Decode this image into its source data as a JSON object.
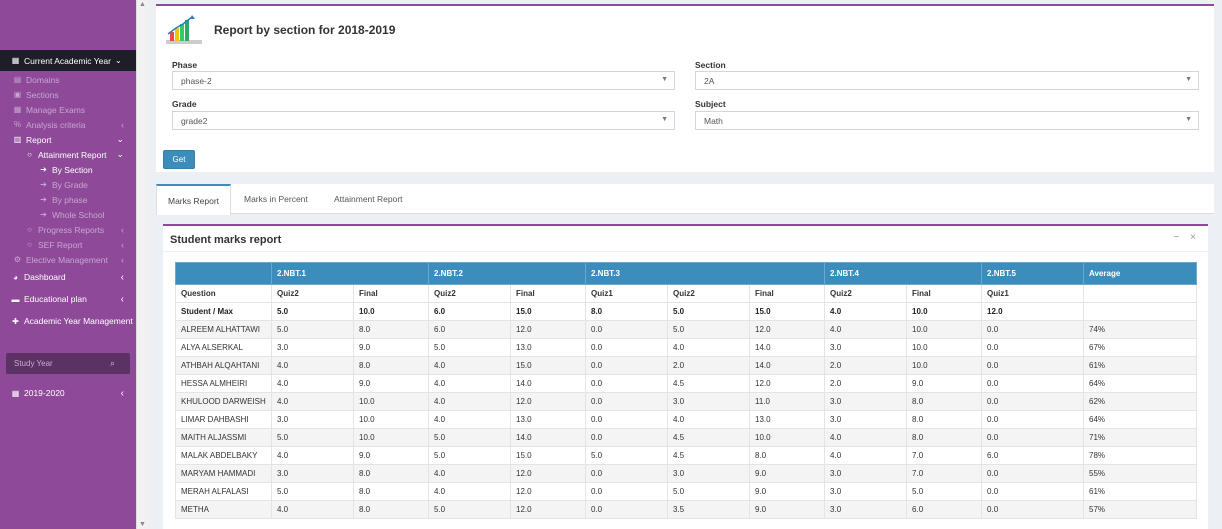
{
  "sidebar": {
    "current_label": "Current Academic Year",
    "items": [
      {
        "label": "Domains",
        "icon": "tags-icon",
        "level": 1,
        "white": false,
        "chev": ""
      },
      {
        "label": "Sections",
        "icon": "users-icon",
        "level": 1,
        "white": false,
        "chev": ""
      },
      {
        "label": "Manage Exams",
        "icon": "table-icon",
        "level": 1,
        "white": false,
        "chev": ""
      },
      {
        "label": "Analysis criteria",
        "icon": "percent-icon",
        "level": 1,
        "white": false,
        "chev": "‹"
      },
      {
        "label": "Report",
        "icon": "bar-chart-icon",
        "level": 1,
        "white": true,
        "chev": "⌄"
      },
      {
        "label": "Attainment Report",
        "icon": "circle-icon",
        "level": 2,
        "white": true,
        "chev": "⌄"
      },
      {
        "label": "By Section",
        "icon": "arrow-right-icon",
        "level": 3,
        "white": true,
        "chev": ""
      },
      {
        "label": "By Grade",
        "icon": "arrow-right-icon",
        "level": 3,
        "white": false,
        "chev": ""
      },
      {
        "label": "By phase",
        "icon": "arrow-right-icon",
        "level": 3,
        "white": false,
        "chev": ""
      },
      {
        "label": "Whole School",
        "icon": "arrow-right-icon",
        "level": 3,
        "white": false,
        "chev": ""
      },
      {
        "label": "Progress Reports",
        "icon": "circle-icon",
        "level": 2,
        "white": false,
        "chev": "‹"
      },
      {
        "label": "SEF Report",
        "icon": "circle-icon",
        "level": 2,
        "white": false,
        "chev": "‹"
      },
      {
        "label": "Elective Management",
        "icon": "gear-icon",
        "level": 1,
        "white": false,
        "chev": "‹"
      }
    ],
    "main_items": [
      {
        "label": "Dashboard",
        "icon": "dashboard-icon",
        "chev": "‹"
      },
      {
        "label": "Educational plan",
        "icon": "book-icon",
        "chev": "‹"
      },
      {
        "label": "Academic Year Management",
        "icon": "plus-icon",
        "chev": ""
      }
    ],
    "search_placeholder": "Study Year",
    "year_item": {
      "label": "2019-2020",
      "icon": "calendar-icon",
      "chev": "‹"
    }
  },
  "filters": {
    "title": "Report by section for 2018-2019",
    "phase_label": "Phase",
    "phase_value": "phase-2",
    "section_label": "Section",
    "section_value": "2A",
    "grade_label": "Grade",
    "grade_value": "grade2",
    "subject_label": "Subject",
    "subject_value": "Math",
    "get_label": "Get"
  },
  "tabs": [
    "Marks Report",
    "Marks in Percent",
    "Attainment Report"
  ],
  "marks": {
    "title": "Student marks report",
    "groups": [
      {
        "label": "",
        "span": 1
      },
      {
        "label": "2.NBT.1",
        "span": 2
      },
      {
        "label": "2.NBT.2",
        "span": 2
      },
      {
        "label": "2.NBT.3",
        "span": 3
      },
      {
        "label": "2.NBT.4",
        "span": 2
      },
      {
        "label": "2.NBT.5",
        "span": 1
      },
      {
        "label": "Average",
        "span": 1
      }
    ],
    "question_row": [
      "Question",
      "Quiz2",
      "Final",
      "Quiz2",
      "Final",
      "Quiz1",
      "Quiz2",
      "Final",
      "Quiz2",
      "Final",
      "Quiz1",
      ""
    ],
    "max_row": [
      "Student / Max",
      "5.0",
      "10.0",
      "6.0",
      "15.0",
      "8.0",
      "5.0",
      "15.0",
      "4.0",
      "10.0",
      "12.0",
      ""
    ],
    "rows": [
      [
        "ALREEM ALHATTAWI",
        "5.0",
        "8.0",
        "6.0",
        "12.0",
        "0.0",
        "5.0",
        "12.0",
        "4.0",
        "10.0",
        "0.0",
        "74%"
      ],
      [
        "ALYA ALSERKAL",
        "3.0",
        "9.0",
        "5.0",
        "13.0",
        "0.0",
        "4.0",
        "14.0",
        "3.0",
        "10.0",
        "0.0",
        "67%"
      ],
      [
        "ATHBAH ALQAHTANI",
        "4.0",
        "8.0",
        "4.0",
        "15.0",
        "0.0",
        "2.0",
        "14.0",
        "2.0",
        "10.0",
        "0.0",
        "61%"
      ],
      [
        "HESSA ALMHEIRI",
        "4.0",
        "9.0",
        "4.0",
        "14.0",
        "0.0",
        "4.5",
        "12.0",
        "2.0",
        "9.0",
        "0.0",
        "64%"
      ],
      [
        "KHULOOD DARWEISH",
        "4.0",
        "10.0",
        "4.0",
        "12.0",
        "0.0",
        "3.0",
        "11.0",
        "3.0",
        "8.0",
        "0.0",
        "62%"
      ],
      [
        "LIMAR DAHBASHI",
        "3.0",
        "10.0",
        "4.0",
        "13.0",
        "0.0",
        "4.0",
        "13.0",
        "3.0",
        "8.0",
        "0.0",
        "64%"
      ],
      [
        "MAITH ALJASSMI",
        "5.0",
        "10.0",
        "5.0",
        "14.0",
        "0.0",
        "4.5",
        "10.0",
        "4.0",
        "8.0",
        "0.0",
        "71%"
      ],
      [
        "MALAK ABDELBAKY",
        "4.0",
        "9.0",
        "5.0",
        "15.0",
        "5.0",
        "4.5",
        "8.0",
        "4.0",
        "7.0",
        "6.0",
        "78%"
      ],
      [
        "MARYAM HAMMADI",
        "3.0",
        "8.0",
        "4.0",
        "12.0",
        "0.0",
        "3.0",
        "9.0",
        "3.0",
        "7.0",
        "0.0",
        "55%"
      ],
      [
        "MERAH ALFALASI",
        "5.0",
        "8.0",
        "4.0",
        "12.0",
        "0.0",
        "5.0",
        "9.0",
        "3.0",
        "5.0",
        "0.0",
        "61%"
      ],
      [
        "METHA",
        "4.0",
        "8.0",
        "5.0",
        "12.0",
        "0.0",
        "3.5",
        "9.0",
        "3.0",
        "6.0",
        "0.0",
        "57%"
      ]
    ]
  },
  "colors": {
    "sidebar": "#8e4a99",
    "accent": "#3c8dbc",
    "dark": "#1e1e28"
  }
}
